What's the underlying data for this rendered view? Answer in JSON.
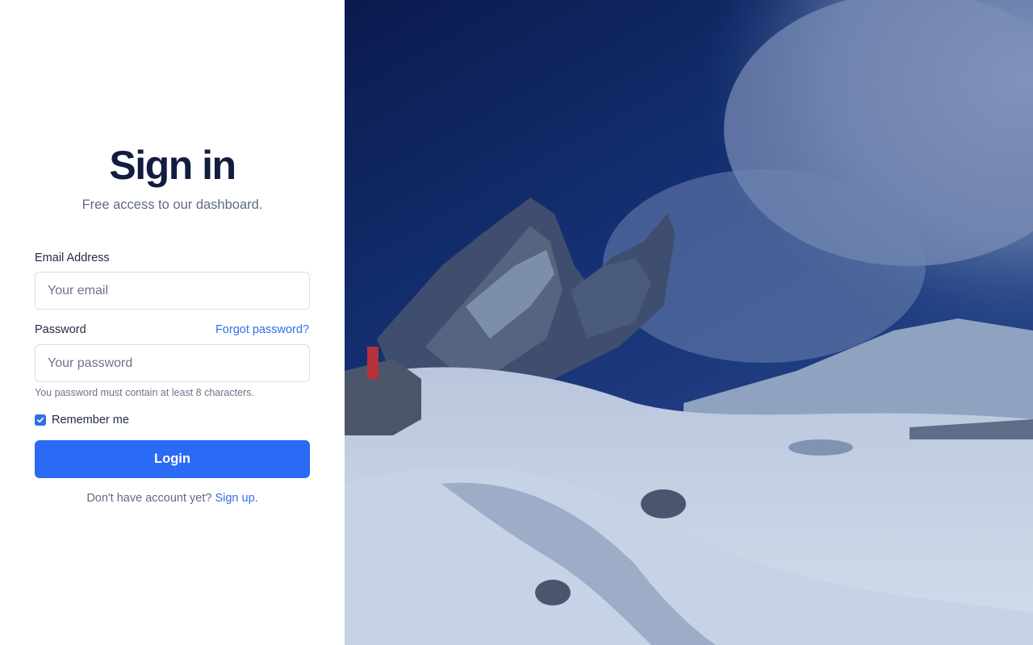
{
  "header": {
    "title": "Sign in",
    "subtitle": "Free access to our dashboard."
  },
  "form": {
    "email_label": "Email Address",
    "email_placeholder": "Your email",
    "email_value": "",
    "password_label": "Password",
    "forgot_label": "Forgot password?",
    "password_placeholder": "Your password",
    "password_value": "",
    "password_hint": "You password must contain at least 8 characters.",
    "remember_label": "Remember me",
    "remember_checked": true,
    "login_label": "Login"
  },
  "footer": {
    "prompt": "Don't have account yet?",
    "signup_label": "Sign up."
  },
  "hero_image": {
    "icon": "snowy-mountain-photo"
  },
  "colors": {
    "accent": "#2a6af5",
    "link": "#2f6fe8",
    "heading": "#111c3f",
    "overlay": "#0c2460"
  }
}
